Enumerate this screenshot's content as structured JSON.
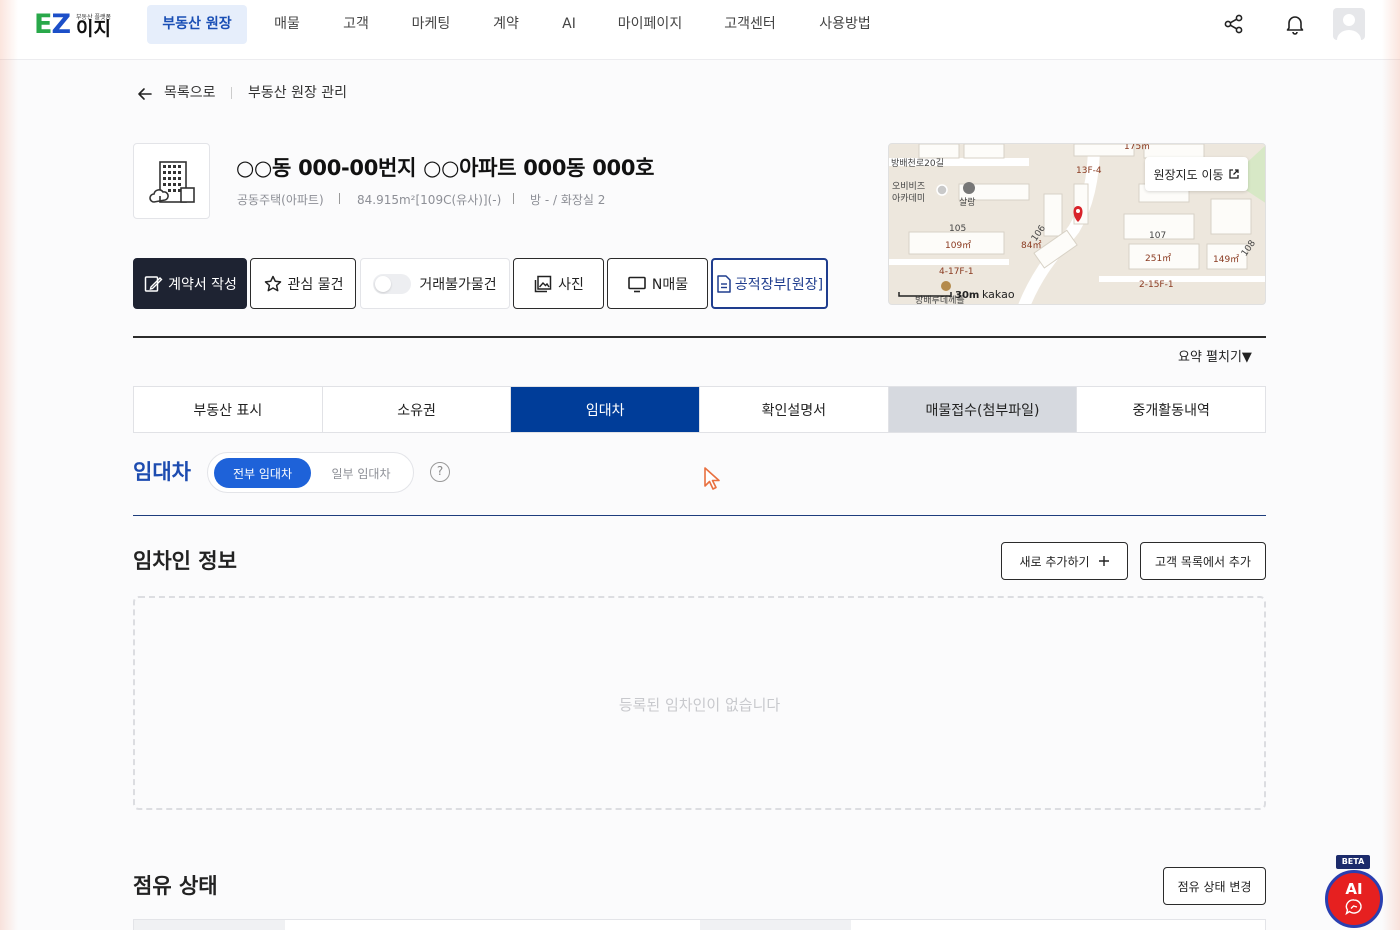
{
  "logo": {
    "tagline": "부동산 플랫폼",
    "brand": "이지"
  },
  "nav": [
    "부동산 원장",
    "매물",
    "고객",
    "마케팅",
    "계약",
    "AI",
    "마이페이지",
    "고객센터",
    "사용방법"
  ],
  "breadcrumb": {
    "back": "목록으로",
    "current": "부동산 원장 관리"
  },
  "property": {
    "title": "○○동 000-00번지 ○○아파트 000동 000호",
    "type": "공동주택(아파트)",
    "area": "84.915m²[109C(유사)](-)",
    "rooms": "방 - / 화장실 2"
  },
  "actions": {
    "contract": "계약서 작성",
    "favorite": "관심 물건",
    "untradable": "거래불가물건",
    "photo": "사진",
    "nlisting": "N매물",
    "registry": "공적장부[원장]"
  },
  "map": {
    "button": "원장지도 이동",
    "scale": "30m",
    "provider": "kakao",
    "labels": [
      "방배천로20길",
      "오비비즈",
      "아카데미",
      "살랑",
      "105",
      "109㎡",
      "106",
      "84㎡",
      "107",
      "251㎡",
      "149㎡",
      "108",
      "4-17F-1",
      "2-15F-1",
      "13F-4",
      "175㎡",
      "방배루데께플"
    ]
  },
  "summary_toggle": "요약 펼치기▼",
  "tabs": [
    "부동산 표시",
    "소유권",
    "임대차",
    "확인설명서",
    "매물접수(첨부파일)",
    "중개활동내역"
  ],
  "lease": {
    "title": "임대차",
    "seg_all": "전부 임대차",
    "seg_part": "일부 임대차",
    "help": "?"
  },
  "tenant": {
    "title": "임차인 정보",
    "add_new": "새로 추가하기",
    "add_from_list": "고객 목록에서 추가",
    "empty": "등록된 임차인이 없습니다"
  },
  "occupancy": {
    "title": "점유 상태",
    "change": "점유 상태 변경"
  },
  "ai_fab": {
    "badge": "BETA",
    "label": "AI"
  }
}
